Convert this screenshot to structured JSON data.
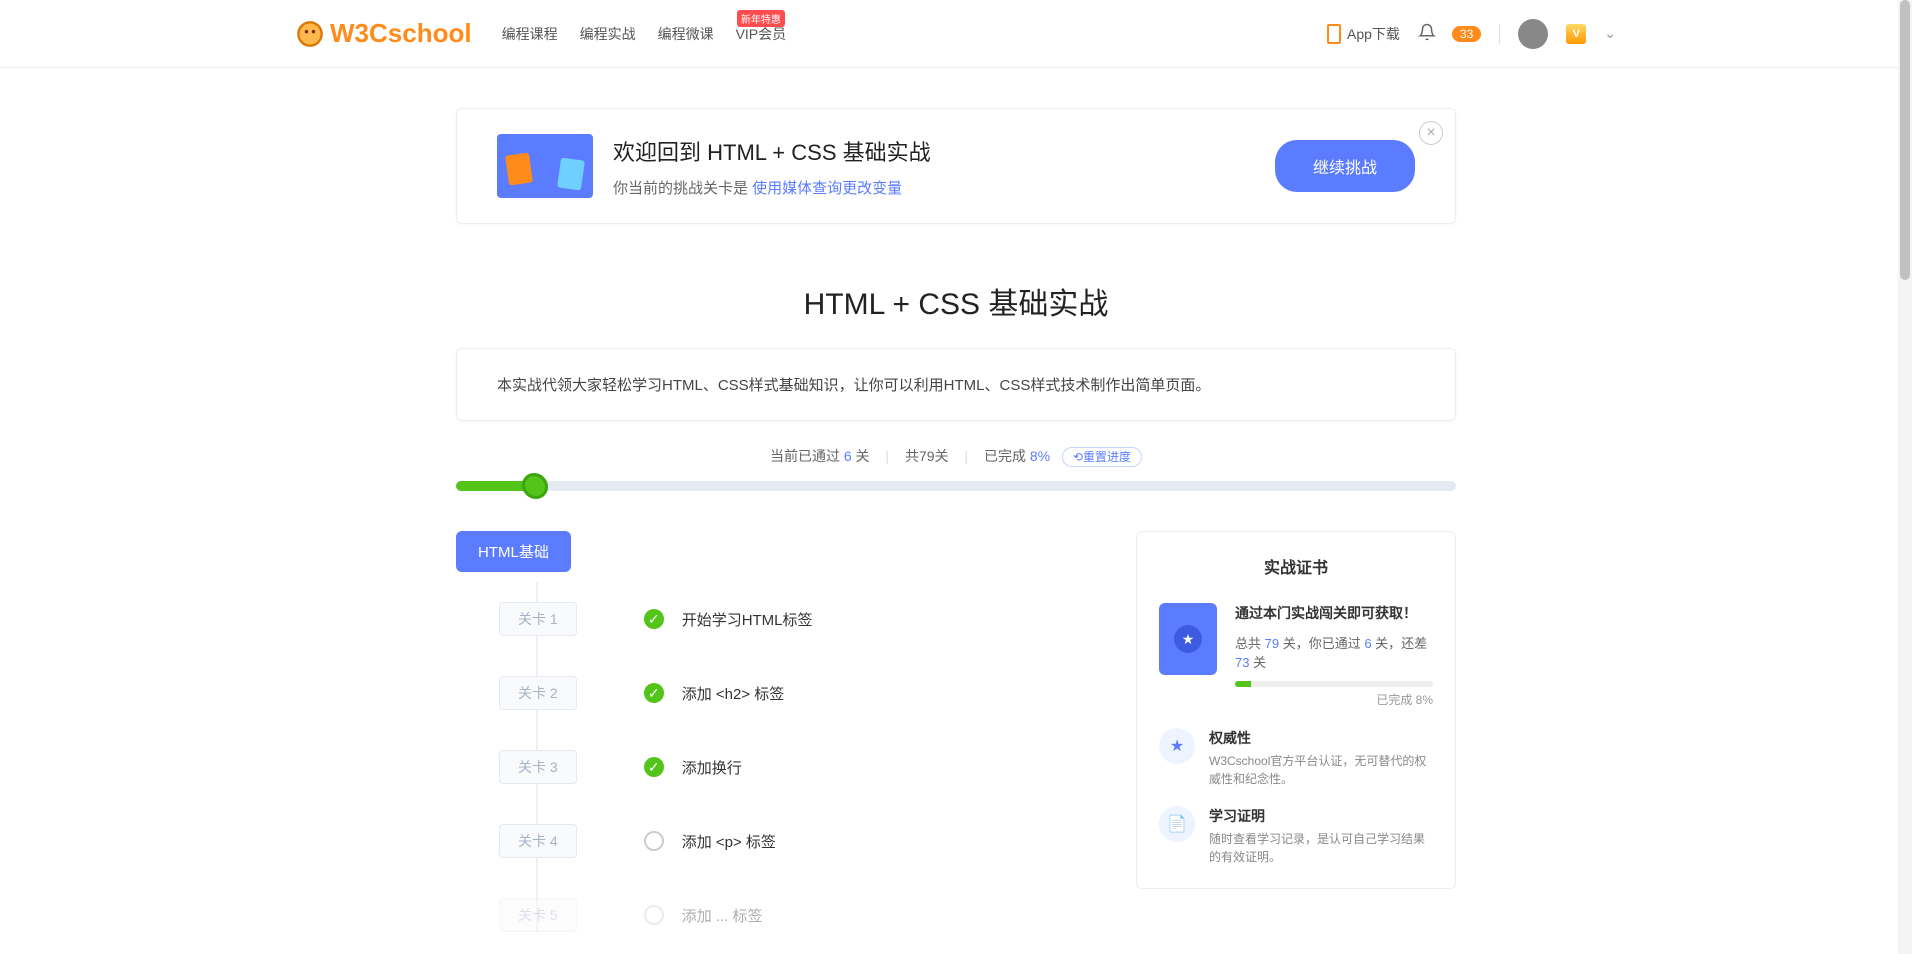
{
  "header": {
    "logo_text": "W3Cschool",
    "nav": [
      {
        "label": "编程课程",
        "badge": null
      },
      {
        "label": "编程实战",
        "badge": null
      },
      {
        "label": "编程微课",
        "badge": null
      },
      {
        "label": "VIP会员",
        "badge": "新年特惠"
      }
    ],
    "app_download": "App下载",
    "notification_count": "33",
    "vip_letter": "V"
  },
  "welcome": {
    "title": "欢迎回到 HTML + CSS 基础实战",
    "subtitle_prefix": "你当前的挑战关卡是 ",
    "subtitle_link": "使用媒体查询更改变量",
    "continue_btn": "继续挑战"
  },
  "page": {
    "title": "HTML + CSS 基础实战",
    "description": "本实战代领大家轻松学习HTML、CSS样式基础知识，让你可以利用HTML、CSS样式技术制作出简单页面。"
  },
  "progress": {
    "passed_prefix": "当前已通过 ",
    "passed_count": "6",
    "passed_suffix": " 关",
    "total_text": "共79关",
    "done_prefix": "已完成 ",
    "done_percent": "8%",
    "reset_label": "重置进度",
    "percent_width": "8%"
  },
  "section": {
    "chip": "HTML基础"
  },
  "levels": [
    {
      "stage": "关卡 1",
      "title": "开始学习HTML标签",
      "done": true
    },
    {
      "stage": "关卡 2",
      "title": "添加 <h2> 标签",
      "done": true
    },
    {
      "stage": "关卡 3",
      "title": "添加换行",
      "done": true
    },
    {
      "stage": "关卡 4",
      "title": "添加 <p> 标签",
      "done": false
    },
    {
      "stage": "关卡 5",
      "title": "添加 ... 标签",
      "done": false
    }
  ],
  "cert": {
    "title": "实战证书",
    "line1": "通过本门实战闯关即可获取！",
    "total_prefix": "总共 ",
    "total": "79",
    "total_suffix": " 关，你已通过 ",
    "passed": "6",
    "passed_suffix": " 关，还差 ",
    "remain": "73",
    "remain_suffix": " 关",
    "mini_label": "已完成 8%",
    "features": [
      {
        "icon": "★",
        "title": "权威性",
        "desc": "W3Cschool官方平台认证，无可替代的权威性和纪念性。"
      },
      {
        "icon": "📄",
        "title": "学习证明",
        "desc": "随时查看学习记录，是认可自己学习结果的有效证明。"
      }
    ]
  }
}
